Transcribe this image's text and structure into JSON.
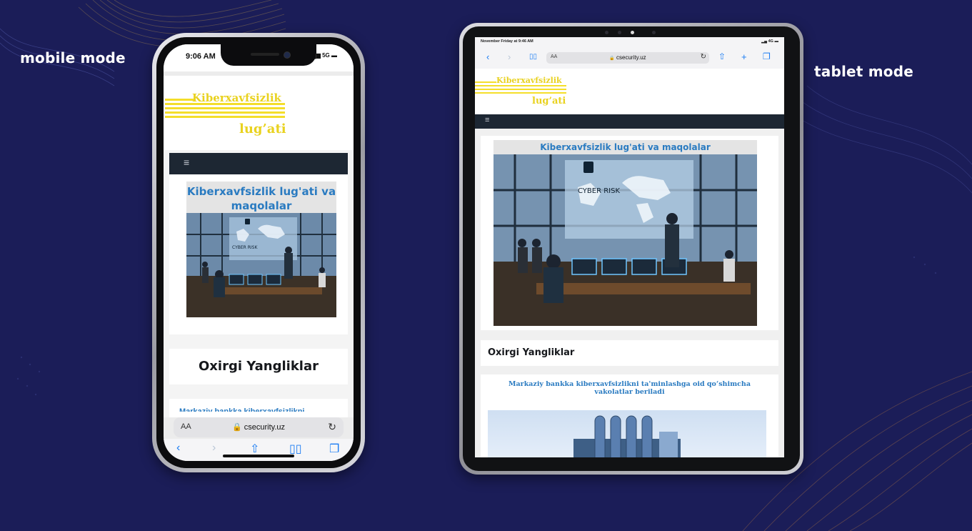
{
  "labels": {
    "mobile": "mobile mode",
    "tablet": "tablet mode"
  },
  "phone": {
    "status_time": "9:06 AM",
    "status_signal": "5G",
    "logo_line1": "Kiberxavfsizlik",
    "logo_line2": "lug’ati",
    "menu_icon": "≡",
    "banner_title": "Kiberxavfsizlik lug'ati va maqolalar",
    "news_title": "Oxirgi Yangliklar",
    "peek_text": "Markaziy bankka kiberxavfsizlikni",
    "address_aa": "AA",
    "address_url": "csecurity.uz",
    "toolbar_icons": [
      "back-icon",
      "forward-icon",
      "share-icon",
      "bookmarks-icon",
      "tabs-icon"
    ]
  },
  "tablet": {
    "status_left": "November Friday at 9:46 AM",
    "status_right": "4G",
    "address_aa": "AA",
    "address_url": "csecurity.uz",
    "logo_line1": "Kiberxavfsizlik",
    "logo_line2": "lug’ati",
    "menu_icon": "≡",
    "banner_title": "Kiberxavfsizlik lug'ati va maqolalar",
    "news_title": "Oxirgi Yangliklar",
    "article_title": "Markaziy bankka kiberxavfsizlikni ta'minlashga oid qo‘shimcha vakolatlar beriladi",
    "toolbar_icons": [
      "back-icon",
      "forward-icon",
      "bookmarks-icon",
      "reload-icon",
      "share-icon",
      "new-tab-icon",
      "tabs-icon"
    ]
  },
  "image_text": {
    "cyber_risk": "CYBER RISK"
  },
  "colors": {
    "background": "#1b1d58",
    "logo_yellow": "#f4de2a",
    "nav_dark": "#1d2733",
    "link_blue": "#2a7bc1",
    "ios_blue": "#1a7cf3"
  }
}
